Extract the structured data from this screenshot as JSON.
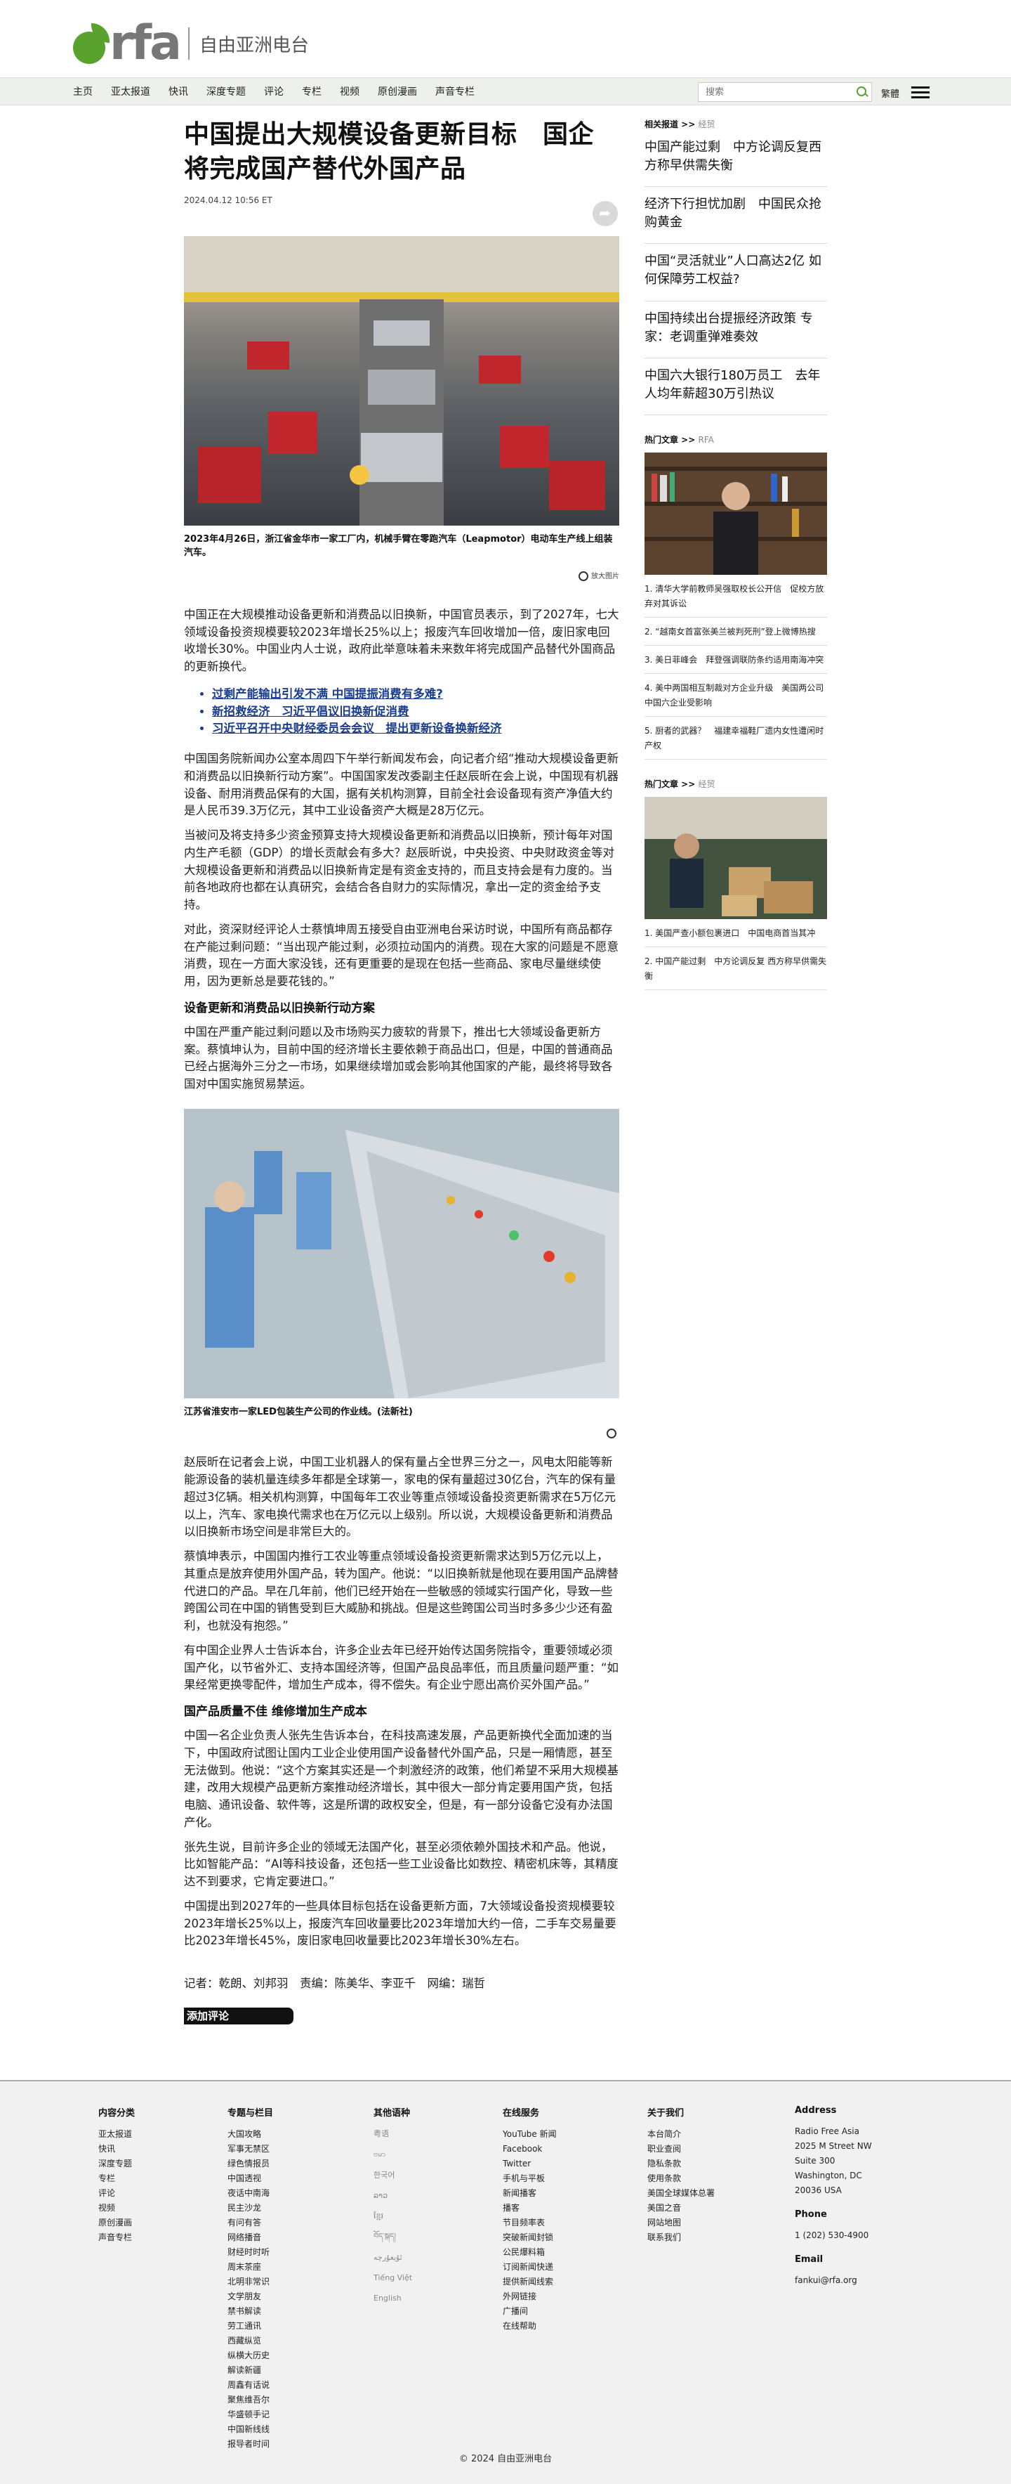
{
  "brand": {
    "logo_text": "rfa",
    "name_cn": "自由亚洲电台",
    "accent": "#5aa22e"
  },
  "nav": {
    "items": [
      "主页",
      "亚太报道",
      "快讯",
      "深度专题",
      "评论",
      "专栏",
      "视频",
      "原创漫画",
      "声音专栏"
    ],
    "search_placeholder": "搜索",
    "lang_label": "繁體"
  },
  "article": {
    "title": "中国提出大规模设备更新目标　国企将完成国产替代外国产品",
    "date": "2024.04.12 10:56 ET",
    "photo1_caption": "2023年4月26日，浙江省金华市一家工厂内，机械手臂在零跑汽车（Leapmotor）电动车生产线上组装汽车。",
    "zoom_label": "放大图片",
    "p1": "中国正在大规模推动设备更新和消费品以旧换新，中国官员表示，到了2027年，七大领域设备投资规模要较2023年增长25%以上；报废汽车回收增加一倍，废旧家电回收增长30%。中国业内人士说，政府此举意味着未来数年将完成国产品替代外国商品的更新换代。",
    "links": [
      "过剩产能输出引发不满 中国提振消费有多难?",
      "新招救经济　习近平倡议旧换新促消费",
      "习近平召开中央财经委员会会议　提出更新设备换新经济"
    ],
    "p2": "中国国务院新闻办公室本周四下午举行新闻发布会，向记者介绍“推动大规模设备更新和消费品以旧换新行动方案”。中国国家发改委副主任赵辰昕在会上说，中国现有机器设备、耐用消费品保有的大国，据有关机构测算，目前全社会设备现有资产净值大约是人民币39.3万亿元，其中工业设备资产大概是28万亿元。",
    "p3": "当被问及将支持多少资金预算支持大规模设备更新和消费品以旧换新，预计每年对国内生产毛额（GDP）的增长贡献会有多大？赵辰昕说，中央投资、中央财政资金等对大规模设备更新和消费品以旧换新肯定是有资金支持的，而且支持会是有力度的。当前各地政府也都在认真研究，会结合各自财力的实际情况，拿出一定的资金给予支持。",
    "p4": "对此，资深财经评论人士蔡慎坤周五接受自由亚洲电台采访时说，中国所有商品都存在产能过剩问题：“当出现产能过剩，必须拉动国内的消费。现在大家的问题是不愿意消费，现在一方面大家没钱，还有更重要的是现在包括一些商品、家电尽量继续使用，因为更新总是要花钱的。”",
    "subhead1": "设备更新和消费品以旧换新行动方案",
    "p5": "中国在严重产能过剩问题以及市场购买力疲软的背景下，推出七大领域设备更新方案。蔡慎坤认为，目前中国的经济增长主要依赖于商品出口，但是，中国的普通商品已经占据海外三分之一市场，如果继续增加或会影响其他国家的产能，最终将导致各国对中国实施贸易禁运。",
    "photo2_caption": "江苏省淮安市一家LED包装生产公司的作业线。(法新社)",
    "p6": "赵辰昕在记者会上说，中国工业机器人的保有量占全世界三分之一，风电太阳能等新能源设备的装机量连续多年都是全球第一，家电的保有量超过30亿台，汽车的保有量超过3亿辆。相关机构测算，中国每年工农业等重点领域设备投资更新需求在5万亿元以上，汽车、家电换代需求也在万亿元以上级别。所以说，大规模设备更新和消费品以旧换新市场空间是非常巨大的。",
    "p7": "蔡慎坤表示，中国国内推行工农业等重点领域设备投资更新需求达到5万亿元以上，其重点是放弃使用外国产品，转为国产。他说：“以旧换新就是他现在要用国产品牌替代进口的产品。早在几年前，他们已经开始在一些敏感的领域实行国产化，导致一些跨国公司在中国的销售受到巨大威胁和挑战。但是这些跨国公司当时多多少少还有盈利，也就没有抱怨。”",
    "p8": "有中国企业界人士告诉本台，许多企业去年已经开始传达国务院指令，重要领域必须国产化，以节省外汇、支持本国经济等，但国产品良品率低，而且质量问题严重：“如果经常更换零配件，增加生产成本，得不偿失。有企业宁愿出高价买外国产品。”",
    "subhead2": "国产品质量不佳 维修增加生产成本",
    "p9": "中国一名企业负责人张先生告诉本台，在科技高速发展，产品更新换代全面加速的当下，中国政府试图让国内工业企业使用国产设备替代外国产品，只是一厢情愿，甚至无法做到。他说：“这个方案其实还是一个刺激经济的政策，他们希望不采用大规模基建，改用大规模产品更新方案推动经济增长，其中很大一部分肯定要用国产货，包括电脑、通讯设备、软件等，这是所谓的政权安全，但是，有一部分设备它没有办法国产化。",
    "p10": "张先生说，目前许多企业的领域无法国产化，甚至必须依赖外国技术和产品。他说，比如智能产品：“AI等科技设备，还包括一些工业设备比如数控、精密机床等，其精度达不到要求，它肯定要进口。”",
    "p11": "中国提出到2027年的一些具体目标包括在设备更新方面，7大领域设备投资规模要较2023年增长25%以上，报废汽车回收量要比2023年增加大约一倍，二手车交易量要比2023年增长45%，废旧家电回收量要比2023年增长30%左右。",
    "byline": "记者：乾朗、刘邦羽　责编：陈美华、李亚千　网编：瑞哲",
    "comment_label": "添加评论"
  },
  "sidebar": {
    "related_head": "相关报道 >>",
    "related_sub": "经贸",
    "related": [
      "中国产能过剩　中方论调反复西方称早供需失衡",
      "经济下行担忧加剧　中国民众抢购黄金",
      "中国“灵活就业”人口高达2亿 如何保障劳工权益?",
      "中国持续出台提振经济政策 专家：老调重弹难奏效",
      "中国六大银行180万员工　去年人均年薪超30万引热议"
    ],
    "hot1_head": "热门文章 >>",
    "hot1_sub": "RFA",
    "hot1": [
      "1. 清华大学前教师吴强取校长公开信　促校方放弃对其诉讼",
      "2. “越南女首富张美兰被判死刑”登上微博热搜",
      "3. 美日菲峰会　拜登强调联防条约适用南海冲突",
      "4. 美中两国相互制裁对方企业升级　美国两公司中国六企业受影响",
      "5. 厨者的武器？　福建幸福鞋厂遗内女性遭闲时产权"
    ],
    "hot2_head": "热门文章 >>",
    "hot2_sub": "经贸",
    "hot2": [
      "1. 美国严查小额包裹进口　中国电商首当其冲",
      "2. 中国产能过剩　中方论调反复 西方称早供需失衡"
    ]
  },
  "footer": {
    "col1": {
      "head": "内容分类",
      "items": [
        "亚太报道",
        "快讯",
        "深度专题",
        "专栏",
        "评论",
        "视频",
        "原创漫画",
        "声音专栏"
      ]
    },
    "col2": {
      "head": "专题与栏目",
      "items": [
        "大国攻略",
        "军事无禁区",
        "绿色情报员",
        "中国透视",
        "夜话中南海",
        "民主沙龙",
        "有问有答",
        "网络播音",
        "财经时时听",
        "周末茶座",
        "北明非常识",
        "文学朋友",
        "禁书解读",
        "劳工通讯",
        "西藏纵览",
        "纵横大历史",
        "解读新疆",
        "周鑫有话说",
        "聚焦维吾尔",
        "华盛顿手记",
        "中国新线线",
        "报导者时间"
      ]
    },
    "col3": {
      "head": "其他语种",
      "items": [
        "粤语",
        "ဗမာ",
        "한국어",
        "ລາວ",
        "ខ្មែរ",
        "བོད་སྐད།",
        "ئۇيغۇرچە",
        "Tiếng Việt",
        "English"
      ]
    },
    "col4": {
      "head": "在线服务",
      "items": [
        "YouTube 新闻",
        "Facebook",
        "Twitter",
        "手机与平板",
        "新闻播客",
        "播客",
        "节目频率表",
        "突破新闻封锁",
        "公民爆料箱",
        "订阅新闻快递",
        "提供新闻线索",
        "外网链接",
        "广播间",
        "在线帮助"
      ]
    },
    "col5": {
      "head": "关于我们",
      "items": [
        "本台简介",
        "职业查阅",
        "隐私条款",
        "使用条款",
        "美国全球媒体总署",
        "美国之音",
        "网站地图",
        "联系我们"
      ]
    },
    "col6": {
      "head": "Address",
      "address": [
        "Radio Free Asia",
        "2025 M Street NW",
        "Suite 300",
        "Washington, DC",
        "20036 USA"
      ],
      "phone_head": "Phone",
      "phone": "1 (202) 530-4900",
      "email_head": "Email",
      "email": "fankui@rfa.org"
    },
    "copyright": "© 2024 自由亚洲电台"
  }
}
